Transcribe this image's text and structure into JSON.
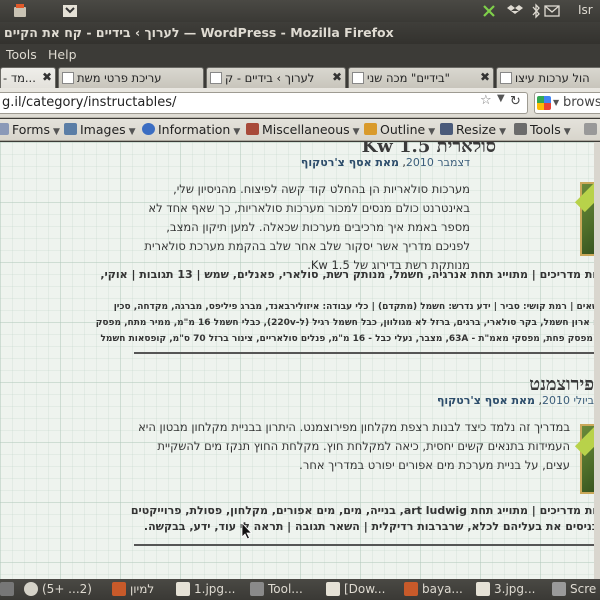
{
  "top_panel": {
    "indicator_lang": "Isr"
  },
  "window": {
    "title": "לערוך › בידיים - קח את הקיים — WordPress - Mozilla Firefox"
  },
  "menu": {
    "items": [
      "Tools",
      "Help"
    ]
  },
  "tabs": [
    {
      "label": "- מד...",
      "active": true
    },
    {
      "label": "עריכת פרטי משת"
    },
    {
      "label": "לערוך › בידיים - ק"
    },
    {
      "label": "בידיים\" מכה שני\""
    },
    {
      "label": "ניהול ערכות עיצו"
    }
  ],
  "navbar": {
    "url": "g.il/category/instructables/",
    "search_placeholder": "brows"
  },
  "webdev_toolbar": {
    "items": [
      "Forms",
      "Images",
      "Information",
      "Miscellaneous",
      "Outline",
      "Resize",
      "Tools"
    ]
  },
  "posts": [
    {
      "title": "סולארית 1.5 Kw",
      "meta_date": "דצמבר 2010",
      "meta_author": "מאת אסף צ'רטקוף",
      "body": "מערכות סולאריות הן בהחלט קוד קשה לפיצוח. מהניסיון שלי, באינטרנט כולם מנסים למכור מערכות סולאריות, כך שאף אחד לא מספר באמת איך מרכיבים מערכות שכאלה. למען תיקון המצב, לפניכם מדריך אשר יסקור שלב אחר שלב בהקמת מערכת סולארית מנותקת רשת בדירוג של Kw 1.5.",
      "cats": "ריות מדריכים | מתוייג תחת אנרגיה, חשמל, מנותק רשת, סולארי, פאנלים, שמש | 13 תגובות | אוקי,",
      "small_lines": [
        "נושאים | רמת קושי: סביר | ידע נדרש: חשמל (מתקדם) | כלי עבודה: איזולירבאנד, מברג פיליפס, מברגה, מקדחה, סכין",
        "יש: ארון חשמל, בקר סולארי, ברגים, ברזל לא מגולוון, כבל חשמל רגיל (ל-220v), כבלי חשמל 16 מ\"מ, ממיר מתח, מפסק",
        "א, מפסק פחת, מפסקי מאמ\"ת - 63A, מצבר, נעלי כבל - 16 מ\"מ, פנלים סולאריים, צינור ברזל 70 ס\"מ, קופסאות חשמל"
      ]
    },
    {
      "title": "פירוצמנט",
      "meta_date": "ביולי 2010",
      "meta_author": "מאת אסף צ'רטקוף",
      "body": "במדריך זה נלמד כיצד לבנות רצפת מקלחון מפירוצמנט. היתרון בבניית מקלחון מבטון היא העמידות בתנאים קשים יחסית, כיאה למקלחת חוץ. מקלחת החוץ תנקז מים להשקיית עצים, על בניית מערכת מים אפורים יפורט במדריך אחר.",
      "cats_html_link": "art ludwig",
      "cats": "ריות מדריכים | מתוייג תחת art ludwig, בנייה, מים, מים אפורים, מקלחון, פסולת, פרוייקטים",
      "cats2": "מכניסים את בעליהם לכלא, שרברבות רדיקלית | השאר תגובה | תראה לי עוד, ידע, בבקשה."
    }
  ],
  "taskbar": {
    "items": [
      "(5+ ...2)",
      "למיון",
      "1.jpg...",
      "Tool...",
      "[Dow...",
      "baya...",
      "3.jpg...",
      "Scre"
    ]
  },
  "colors": {
    "panel": "#3c3b37",
    "link": "#2c4c6a",
    "ribbon": "#b8d24a"
  }
}
